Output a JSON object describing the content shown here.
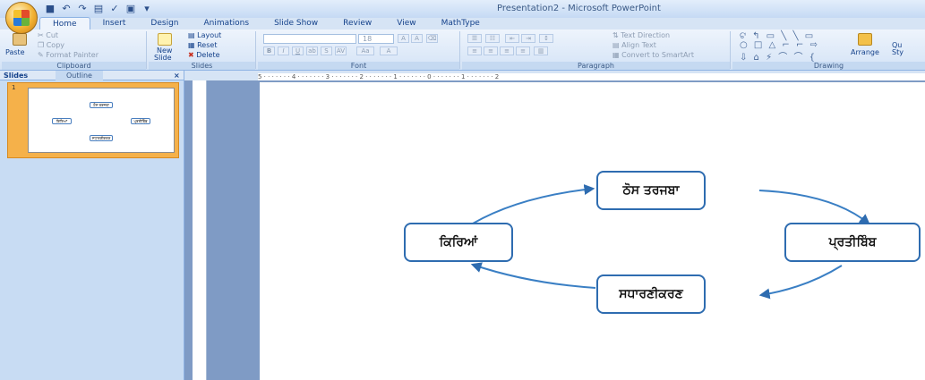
{
  "window": {
    "title": "Presentation2 - Microsoft PowerPoint"
  },
  "tabs": [
    "Home",
    "Insert",
    "Design",
    "Animations",
    "Slide Show",
    "Review",
    "View",
    "MathType"
  ],
  "clipboard": {
    "paste": "Paste",
    "cut": "Cut",
    "copy": "Copy",
    "format_painter": "Format Painter",
    "label": "Clipboard"
  },
  "slides_group": {
    "new_slide": "New",
    "new_slide2": "Slide",
    "layout": "Layout",
    "reset": "Reset",
    "delete": "Delete",
    "label": "Slides"
  },
  "font": {
    "size": "18",
    "label": "Font"
  },
  "paragraph": {
    "text_direction": "Text Direction",
    "align_text": "Align Text",
    "convert": "Convert to SmartArt",
    "label": "Paragraph"
  },
  "drawing": {
    "arrange": "Arrange",
    "label": "Drawing",
    "quick_styles_partial": "Qu\nSty"
  },
  "panel": {
    "tab_slides": "Slides",
    "tab_outline": "Outline",
    "close": "×",
    "slide_number": "1"
  },
  "ruler": {
    "marks": "5 · · · · · · · 4 · · · · · · · 3 · · · · · · · 2 · · · · · · · 1 · · · · · · · 0 · · · · · · · 1 · · · · · · · 2"
  },
  "diagram": {
    "nodes": {
      "top": "ਠੋਸ ਤਰਜਬਾ",
      "right": "ਪ੍ਰਤੀਬਿੰਬ",
      "bottom": "ਸਧਾਰਣੀਕਰਣ",
      "left": "ਕਿਰਿਆਂ"
    }
  }
}
